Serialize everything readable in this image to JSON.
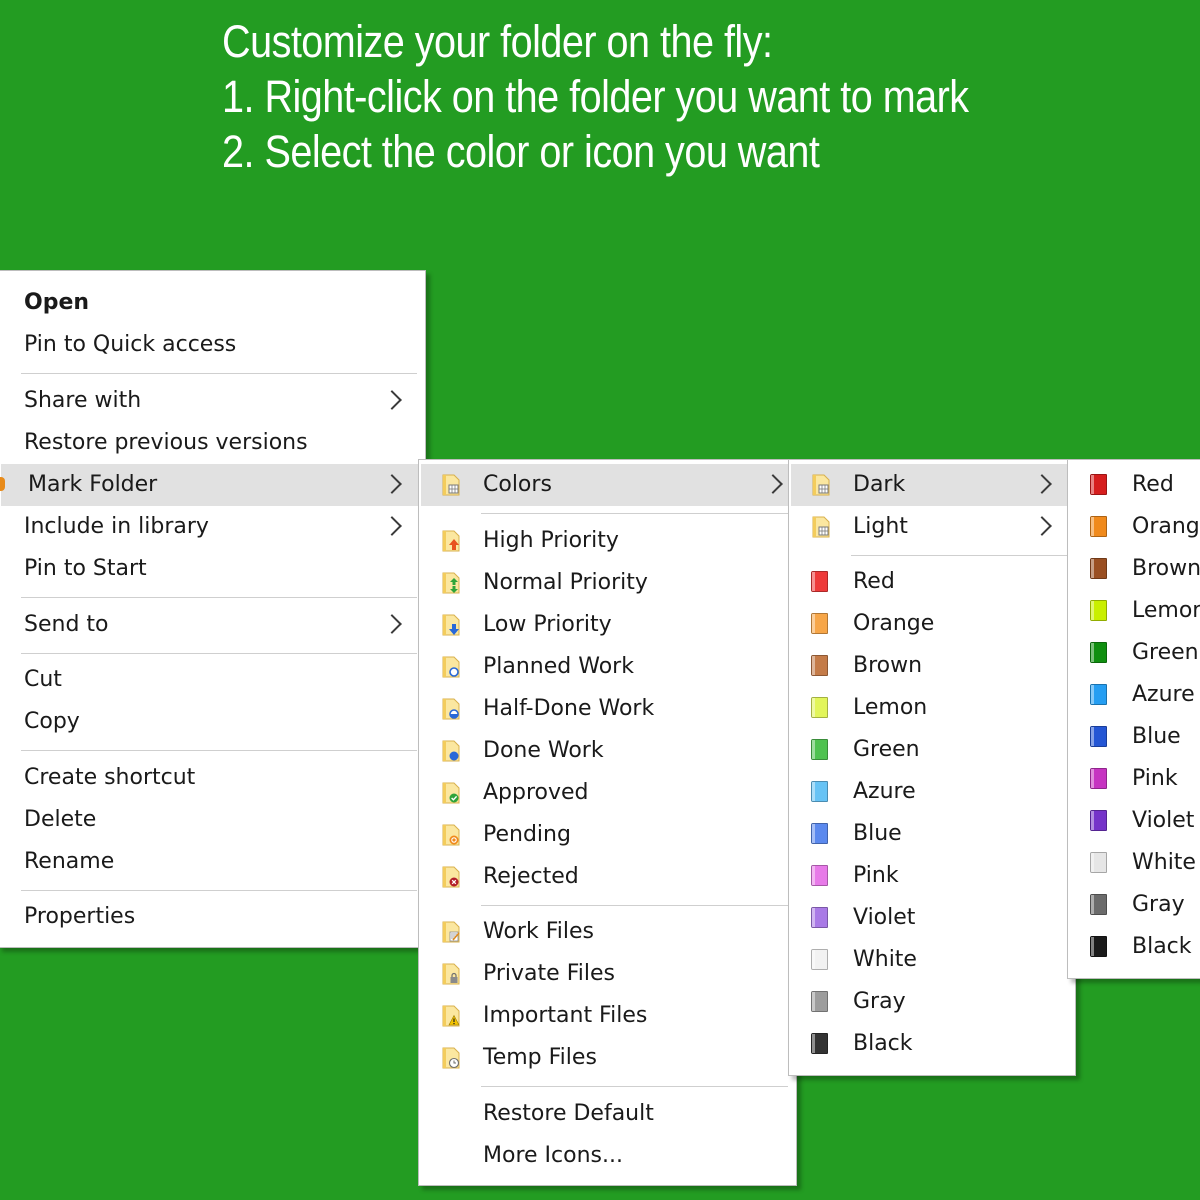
{
  "headline": {
    "line1": "Customize your folder on the fly:",
    "line2": "1. Right-click on the folder you want to mark",
    "line3": "2. Select the color or icon you want"
  },
  "colors": {
    "background": "#239c22",
    "menu_bg": "#ffffff",
    "highlight": "#e1e1e1"
  },
  "main_menu": {
    "open": "Open",
    "pin_quick_access": "Pin to Quick access",
    "share_with": "Share with",
    "restore_previous": "Restore previous versions",
    "mark_folder": "Mark Folder",
    "include_library": "Include in library",
    "pin_start": "Pin to Start",
    "send_to": "Send to",
    "cut": "Cut",
    "copy": "Copy",
    "create_shortcut": "Create shortcut",
    "delete": "Delete",
    "rename": "Rename",
    "properties": "Properties"
  },
  "mark_menu": {
    "colors": "Colors",
    "high_priority": "High Priority",
    "normal_priority": "Normal Priority",
    "low_priority": "Low Priority",
    "planned_work": "Planned Work",
    "half_done_work": "Half-Done Work",
    "done_work": "Done Work",
    "approved": "Approved",
    "pending": "Pending",
    "rejected": "Rejected",
    "work_files": "Work Files",
    "private_files": "Private Files",
    "important_files": "Important Files",
    "temp_files": "Temp Files",
    "restore_default": "Restore Default",
    "more_icons": "More Icons..."
  },
  "colors_menu": {
    "dark": "Dark",
    "light": "Light",
    "items": [
      {
        "label": "Red",
        "color": "#ee3a3a"
      },
      {
        "label": "Orange",
        "color": "#f7a648"
      },
      {
        "label": "Brown",
        "color": "#c47b48"
      },
      {
        "label": "Lemon",
        "color": "#e2f55a"
      },
      {
        "label": "Green",
        "color": "#4fc250"
      },
      {
        "label": "Azure",
        "color": "#67c3f5"
      },
      {
        "label": "Blue",
        "color": "#5b89ee"
      },
      {
        "label": "Pink",
        "color": "#e77ae8"
      },
      {
        "label": "Violet",
        "color": "#a97ae6"
      },
      {
        "label": "White",
        "color": "#f2f2f2"
      },
      {
        "label": "Gray",
        "color": "#9d9d9d"
      },
      {
        "label": "Black",
        "color": "#333333"
      }
    ]
  },
  "dark_menu": {
    "items": [
      {
        "label": "Red",
        "color": "#d61e1e"
      },
      {
        "label": "Orange",
        "color": "#f08a1c"
      },
      {
        "label": "Brown",
        "color": "#9a4f22"
      },
      {
        "label": "Lemon",
        "color": "#c9ef00"
      },
      {
        "label": "Green",
        "color": "#108f10"
      },
      {
        "label": "Azure",
        "color": "#259ef2"
      },
      {
        "label": "Blue",
        "color": "#2456d4"
      },
      {
        "label": "Pink",
        "color": "#c634c1"
      },
      {
        "label": "Violet",
        "color": "#7533c9"
      },
      {
        "label": "White",
        "color": "#e6e6e6"
      },
      {
        "label": "Gray",
        "color": "#6b6b6b"
      },
      {
        "label": "Black",
        "color": "#1a1a1a"
      }
    ]
  }
}
